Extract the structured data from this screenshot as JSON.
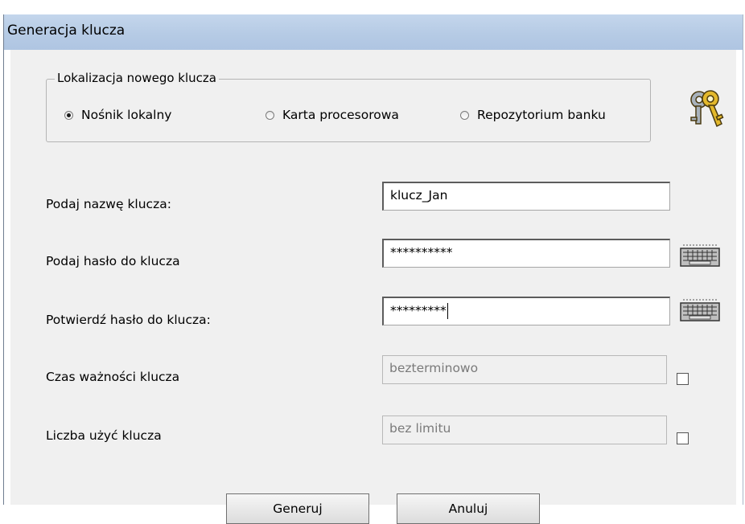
{
  "window": {
    "title": "Generacja klucza"
  },
  "location_group": {
    "legend": "Lokalizacja nowego klucza",
    "options": [
      {
        "label": "Nośnik lokalny",
        "checked": true
      },
      {
        "label": "Karta procesorowa",
        "checked": false
      },
      {
        "label": "Repozytorium banku",
        "checked": false
      }
    ]
  },
  "fields": {
    "key_name": {
      "label": "Podaj nazwę klucza:",
      "value": "klucz_Jan"
    },
    "password": {
      "label": "Podaj hasło do klucza",
      "value": "**********"
    },
    "password_confirm": {
      "label": "Potwierdź hasło do klucza:",
      "value": "*********"
    },
    "validity": {
      "label": "Czas ważności klucza",
      "value": "bezterminowo",
      "checked": false
    },
    "usage_count": {
      "label": "Liczba użyć klucza",
      "value": "bez limitu",
      "checked": false
    }
  },
  "buttons": {
    "generate": "Generuj",
    "cancel": "Anuluj"
  },
  "icons": {
    "keys": "keys-icon",
    "keyboard": "keyboard-icon"
  }
}
